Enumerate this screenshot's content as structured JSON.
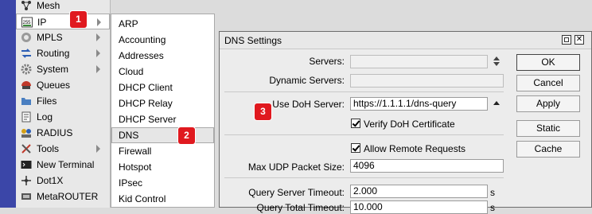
{
  "main_menu": [
    {
      "label": "Mesh",
      "icon": "mesh-icon"
    },
    {
      "label": "IP",
      "icon": "ip-icon",
      "submenu": true,
      "selected": true
    },
    {
      "label": "MPLS",
      "icon": "mpls-icon",
      "submenu": true
    },
    {
      "label": "Routing",
      "icon": "routing-icon",
      "submenu": true
    },
    {
      "label": "System",
      "icon": "system-gear-icon",
      "submenu": true
    },
    {
      "label": "Queues",
      "icon": "queues-icon"
    },
    {
      "label": "Files",
      "icon": "files-folder-icon"
    },
    {
      "label": "Log",
      "icon": "log-icon"
    },
    {
      "label": "RADIUS",
      "icon": "radius-icon"
    },
    {
      "label": "Tools",
      "icon": "tools-icon",
      "submenu": true
    },
    {
      "label": "New Terminal",
      "icon": "terminal-icon"
    },
    {
      "label": "Dot1X",
      "icon": "dot1x-icon"
    },
    {
      "label": "MetaROUTER",
      "icon": "metarouter-icon"
    }
  ],
  "ip_submenu": [
    "ARP",
    "Accounting",
    "Addresses",
    "Cloud",
    "DHCP Client",
    "DHCP Relay",
    "DHCP Server",
    "DNS",
    "Firewall",
    "Hotspot",
    "IPsec",
    "Kid Control"
  ],
  "badges": {
    "b1": "1",
    "b2": "2",
    "b3": "3"
  },
  "dialog": {
    "title": "DNS Settings",
    "labels": {
      "servers": "Servers:",
      "dynamic_servers": "Dynamic Servers:",
      "use_doh": "Use DoH Server:",
      "max_udp": "Max UDP Packet Size:",
      "query_server_timeout": "Query Server Timeout:",
      "query_total_timeout": "Query Total Timeout:"
    },
    "values": {
      "servers": "",
      "dynamic_servers": "",
      "use_doh": "https://1.1.1.1/dns-query",
      "max_udp": "4096",
      "query_server_timeout": "2.000",
      "query_total_timeout": "10.000"
    },
    "units": {
      "s1": "s",
      "s2": "s"
    },
    "checkboxes": {
      "verify_doh": {
        "label": "Verify DoH Certificate",
        "checked": true
      },
      "allow_remote": {
        "label": "Allow Remote Requests",
        "checked": true
      }
    },
    "buttons": {
      "ok": "OK",
      "cancel": "Cancel",
      "apply": "Apply",
      "static": "Static",
      "cache": "Cache"
    }
  },
  "colors": {
    "badge": "#e0191f",
    "left_strip": "#3b46a8"
  }
}
